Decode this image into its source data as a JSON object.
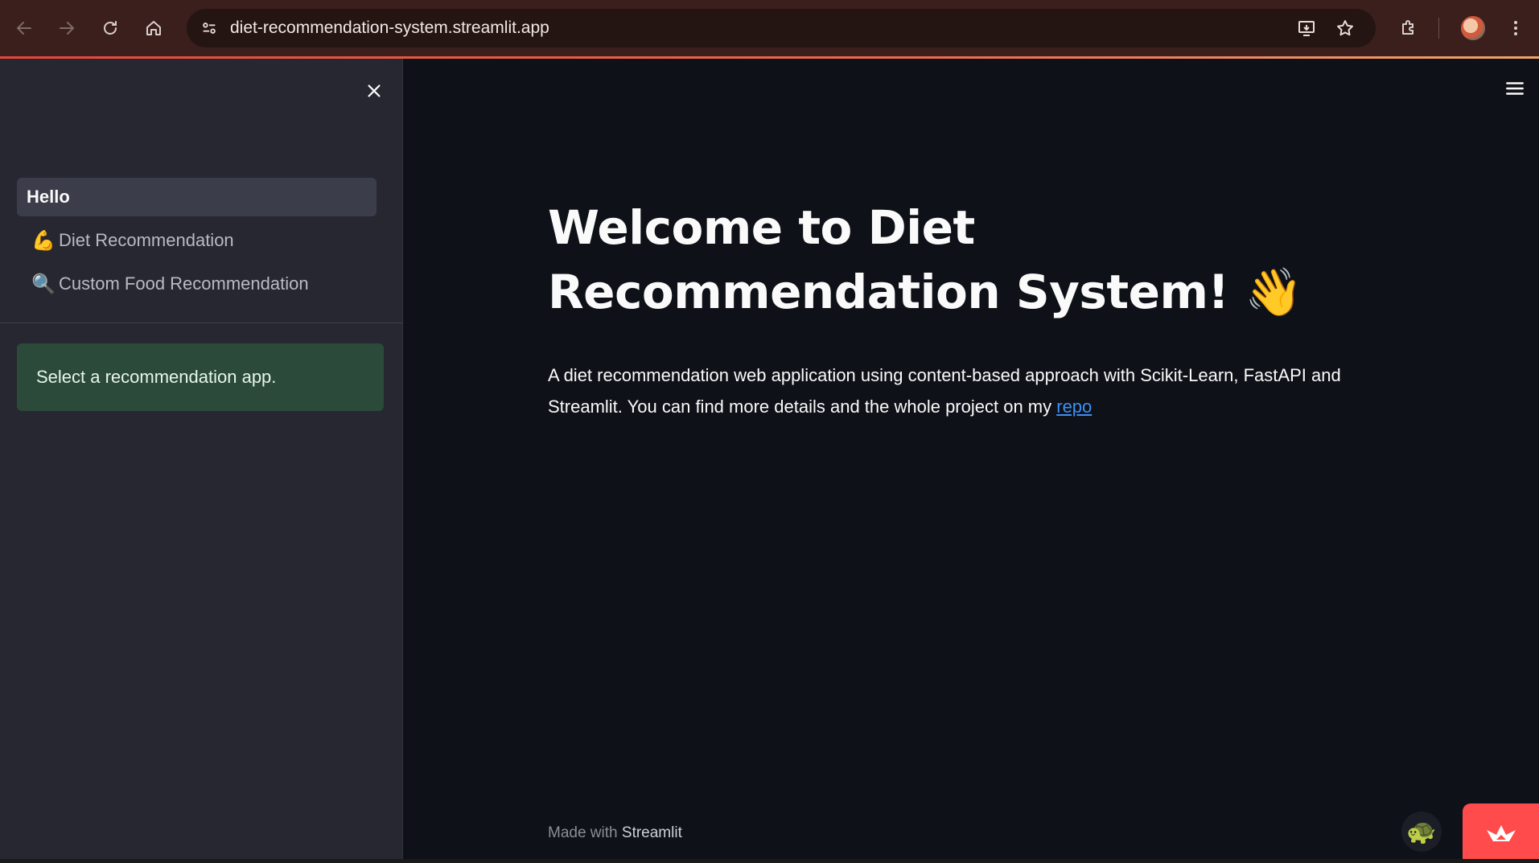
{
  "browser": {
    "url": "diet-recommendation-system.streamlit.app",
    "icons": {
      "back": "back-arrow-icon",
      "forward": "forward-arrow-icon",
      "reload": "reload-icon",
      "home": "home-icon",
      "site_info": "tune-icon",
      "install": "install-app-icon",
      "bookmark": "star-icon",
      "extensions": "puzzle-icon",
      "menu": "kebab-menu-icon"
    },
    "accent_color": "#e8453c"
  },
  "sidebar": {
    "nav": [
      {
        "label": "Hello",
        "emoji": "",
        "active": true
      },
      {
        "label": "Diet Recommendation",
        "emoji": "💪",
        "active": false
      },
      {
        "label": "Custom Food Recommendation",
        "emoji": "🔍",
        "active": false
      }
    ],
    "info_message": "Select a recommendation app.",
    "info_color": "#2b4a3a"
  },
  "main": {
    "title": "Welcome to Diet Recommendation System!",
    "title_emoji": "👋",
    "description_prefix": "A diet recommendation web application using content-based approach with Scikit-Learn, FastAPI and Streamlit. You can find more details and the whole project on my ",
    "link_text": "repo",
    "footer_prefix": "Made with",
    "footer_brand": "Streamlit",
    "link_color": "#3d8ff5",
    "badge_color": "#ff4b4b"
  }
}
